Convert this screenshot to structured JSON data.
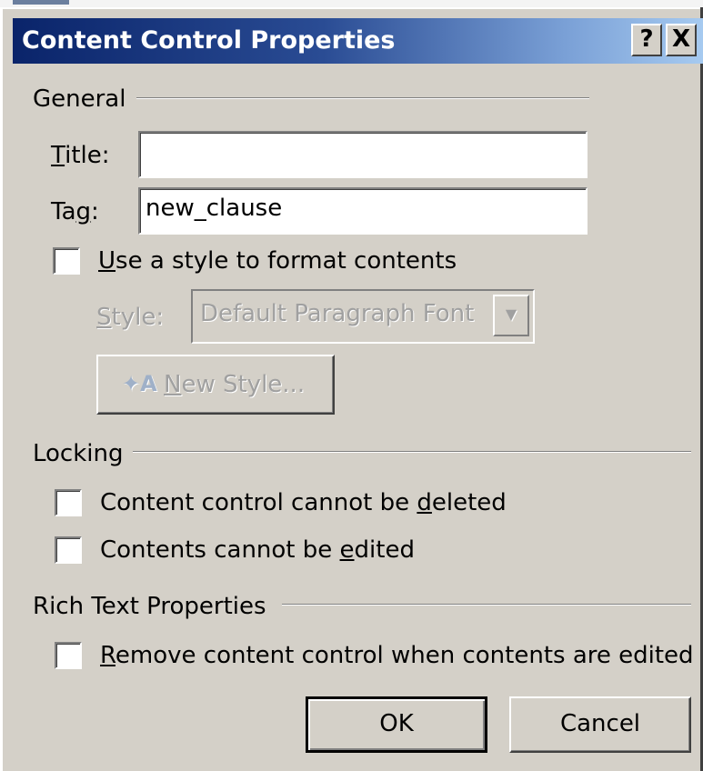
{
  "dialog": {
    "title": "Content Control Properties",
    "help_button": "?",
    "close_button": "X"
  },
  "general": {
    "section_label": "General",
    "title_label_accel": "T",
    "title_label_rest": "itle:",
    "title_value": "",
    "tag_label_pre": "Ta",
    "tag_label_accel": "g",
    "tag_label_post": ":",
    "tag_value": "new_clause",
    "use_style_accel": "U",
    "use_style_rest": "se a style to format contents",
    "use_style_checked": false,
    "style_label_accel": "S",
    "style_label_rest": "tyle:",
    "style_value": "Default Paragraph Font",
    "new_style_icon": "new-style-icon",
    "new_style_accel": "N",
    "new_style_rest": "ew Style..."
  },
  "locking": {
    "section_label": "Locking",
    "cannot_delete_pre": "Content control cannot be ",
    "cannot_delete_accel": "d",
    "cannot_delete_post": "eleted",
    "cannot_delete_checked": false,
    "cannot_edit_pre": "Contents cannot be ",
    "cannot_edit_accel": "e",
    "cannot_edit_post": "dited",
    "cannot_edit_checked": false
  },
  "rich_text": {
    "section_label": "Rich Text Properties",
    "remove_accel": "R",
    "remove_rest": "emove content control when contents are edited",
    "remove_checked": false
  },
  "buttons": {
    "ok": "OK",
    "cancel": "Cancel"
  },
  "colors": {
    "dialog_bg": "#d4d0c8",
    "titlebar_start": "#0a246a",
    "titlebar_end": "#a6caf0",
    "disabled_text": "#a0a0a0"
  }
}
